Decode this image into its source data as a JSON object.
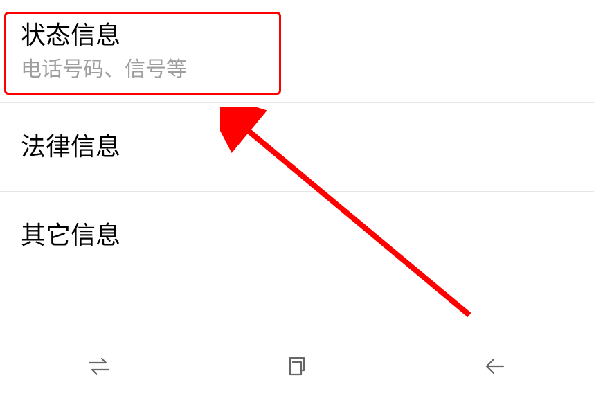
{
  "settings": {
    "items": [
      {
        "title": "状态信息",
        "subtitle": "电话号码、信号等"
      },
      {
        "title": "法律信息"
      },
      {
        "title": "其它信息"
      }
    ]
  },
  "annotation": {
    "highlight_color": "#ff0000"
  }
}
